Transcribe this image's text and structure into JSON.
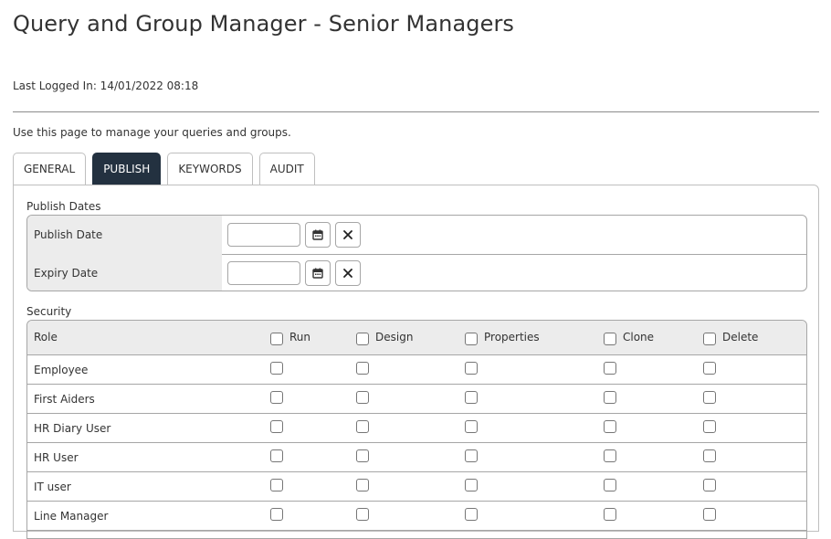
{
  "page": {
    "title": "Query and Group Manager - Senior Managers",
    "last_logged_in": "Last Logged In: 14/01/2022 08:18",
    "intro": "Use this page to manage your queries and groups."
  },
  "tabs": [
    {
      "label": "GENERAL",
      "active": false
    },
    {
      "label": "PUBLISH",
      "active": true
    },
    {
      "label": "KEYWORDS",
      "active": false
    },
    {
      "label": "AUDIT",
      "active": false
    }
  ],
  "publish_dates": {
    "heading": "Publish Dates",
    "rows": [
      {
        "label": "Publish Date",
        "value": ""
      },
      {
        "label": "Expiry Date",
        "value": ""
      }
    ]
  },
  "security": {
    "heading": "Security",
    "role_header": "Role",
    "columns": [
      "Run",
      "Design",
      "Properties",
      "Clone",
      "Delete"
    ],
    "roles": [
      "Employee",
      "First Aiders",
      "HR Diary User",
      "HR User",
      "IT user",
      "Line Manager"
    ]
  },
  "colors": {
    "active_tab_bg": "#233140",
    "header_bg": "#ececec",
    "border": "#a6a6a6"
  },
  "icons": {
    "calendar": "calendar-icon",
    "clear": "close-icon"
  }
}
